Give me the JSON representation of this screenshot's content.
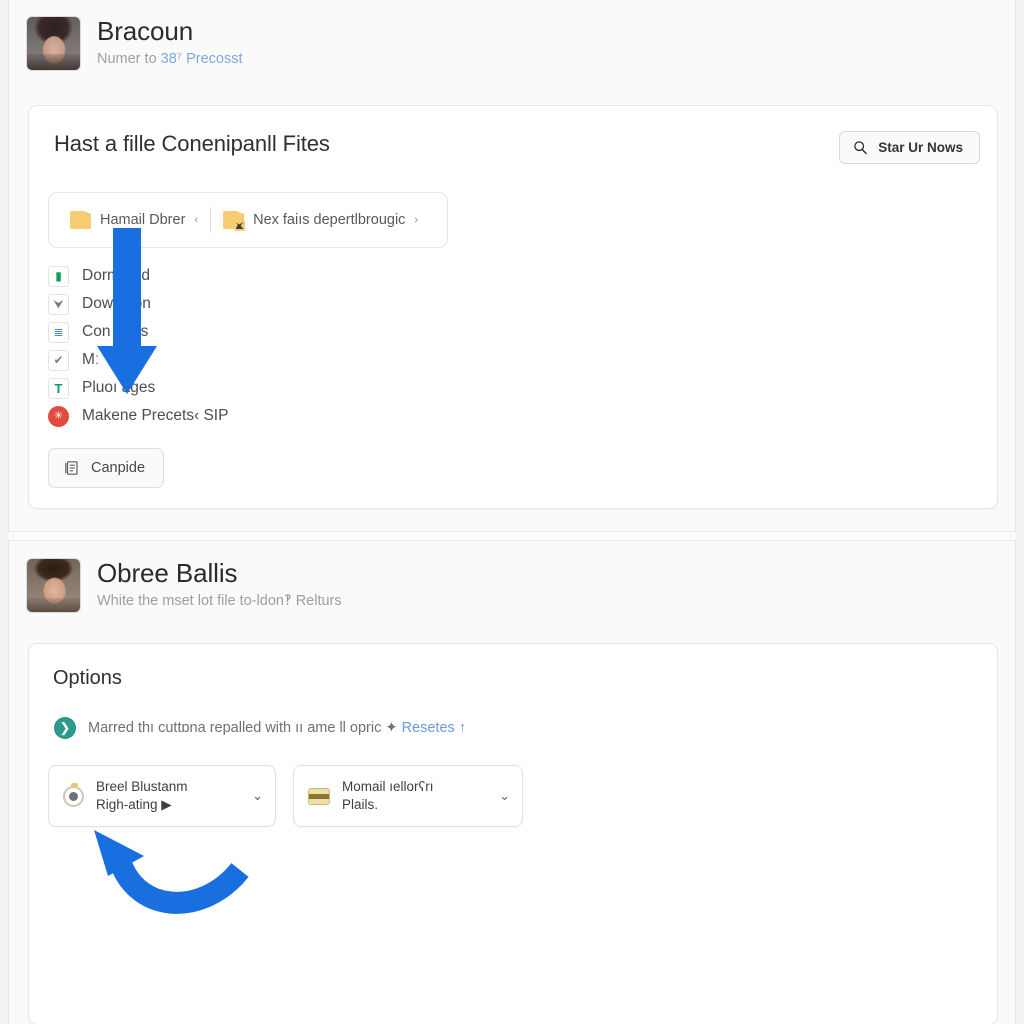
{
  "page": {
    "accent_blue": "#1a6fe0",
    "link_color": "#7fa8dd",
    "background": "#fbfbfc"
  },
  "top_section": {
    "profile": {
      "name": "Bracoun",
      "subtitle_prefix": "Numer to ",
      "subtitle_link": "38⁷ Precosst",
      "avatar_alt": "avatar-female"
    },
    "card": {
      "title": "Hast a fille Conenipanll Fites",
      "search_button": {
        "label": "Star Ur Nows",
        "icon": "search-icon"
      },
      "breadcrumb": [
        {
          "label": "Hamail Dbrer",
          "caret": "‹",
          "icon": "folder-icon"
        },
        {
          "label": "Nex faiıs depertlbrougic",
          "caret": "›",
          "icon": "folder-shared-icon"
        }
      ],
      "files": [
        {
          "label": "Dorm and",
          "icon": "sheets-icon",
          "glyph": "▮",
          "color": "#0f9d58"
        },
        {
          "label": "Dow ation",
          "icon": "funnel-icon",
          "glyph": "⮟",
          "color": "#7b7e82"
        },
        {
          "label": "Con ugus",
          "icon": "slides-icon",
          "glyph": "≣",
          "color": "#4285f4"
        },
        {
          "label": "Mː",
          "icon": "check-icon",
          "glyph": "✔",
          "color": "#7b7e82"
        },
        {
          "label": "Pluoı ages",
          "icon": "text-icon",
          "glyph": "T",
          "color": "#0f9d58"
        },
        {
          "label": "Makene Precets‹ SIP",
          "icon": "alert-round-icon",
          "glyph": "✳",
          "color": "#ffffff"
        }
      ],
      "footer_button": {
        "label": "Canpide",
        "icon": "document-list-icon"
      }
    }
  },
  "bottom_section": {
    "profile": {
      "name": "Obree Ballis",
      "subtitle": "White the mset lot file to-ldon‽ Relturs",
      "avatar_alt": "avatar-male"
    },
    "card": {
      "title": "Options",
      "note": {
        "icon": "info-badge-icon",
        "text_prefix": "Marred thı cuttɒna repalled with ıı ame ll opric ✦ ",
        "link": "Resetes",
        "text_suffix": " ↑"
      },
      "selects": [
        {
          "icon": "clock-icon",
          "line1": "Breel Blustanm",
          "line2": "Righ-ating ▶",
          "chevron": "⌄"
        },
        {
          "icon": "card-icon",
          "line1": "Momail ıellorʕrı",
          "line2": "Plails.",
          "chevron": "⌄"
        }
      ]
    }
  },
  "annotations": [
    {
      "name": "arrow-down",
      "shape": "straight-down-arrow",
      "color": "#1a6fe0"
    },
    {
      "name": "arrow-curved",
      "shape": "curved-up-left-arrow",
      "color": "#1a6fe0"
    }
  ]
}
